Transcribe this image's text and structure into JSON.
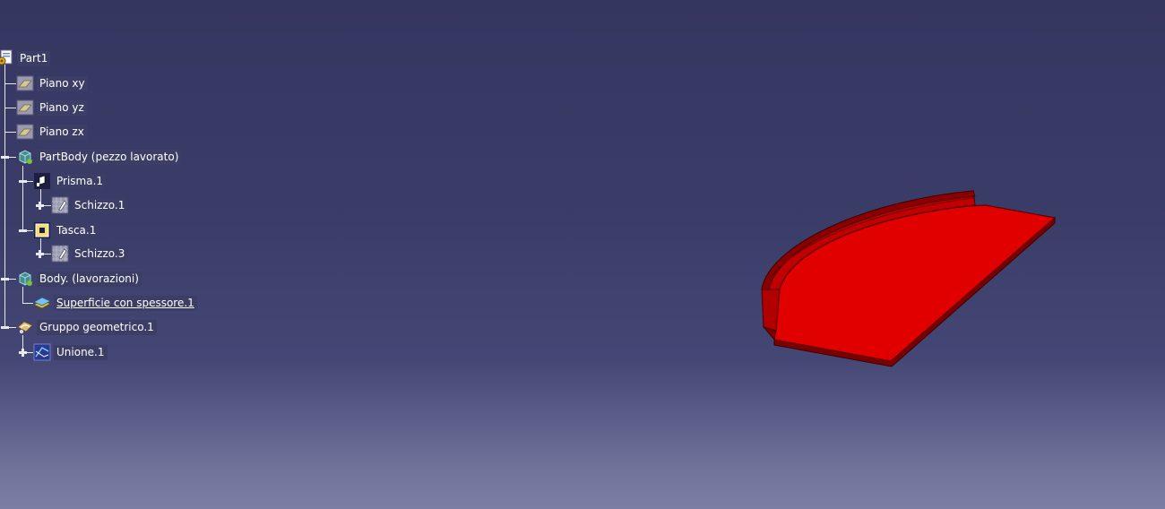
{
  "colors": {
    "background_top": "#353660",
    "background_bottom": "#7b7fa3",
    "part_fill": "#e10000",
    "part_edge": "#5a0000",
    "tree_line": "#e8e8f0"
  },
  "tree": {
    "root": {
      "label": "Part1",
      "icon": "part-document-icon"
    },
    "items": [
      {
        "label": "Piano xy",
        "icon": "plane-icon"
      },
      {
        "label": "Piano yz",
        "icon": "plane-icon"
      },
      {
        "label": "Piano zx",
        "icon": "plane-icon"
      },
      {
        "label": "PartBody (pezzo lavorato)",
        "icon": "body-icon"
      },
      {
        "label": "Prisma.1",
        "icon": "pad-icon"
      },
      {
        "label": "Schizzo.1",
        "icon": "sketch-icon"
      },
      {
        "label": "Tasca.1",
        "icon": "pocket-icon"
      },
      {
        "label": "Schizzo.3",
        "icon": "sketch-icon"
      },
      {
        "label": "Body. (lavorazioni)",
        "icon": "body-icon"
      },
      {
        "label": "Superficie con spessore.1",
        "icon": "thick-surface-icon"
      },
      {
        "label": "Gruppo geometrico.1",
        "icon": "geometrical-set-icon"
      },
      {
        "label": "Unione.1",
        "icon": "join-icon"
      }
    ]
  }
}
